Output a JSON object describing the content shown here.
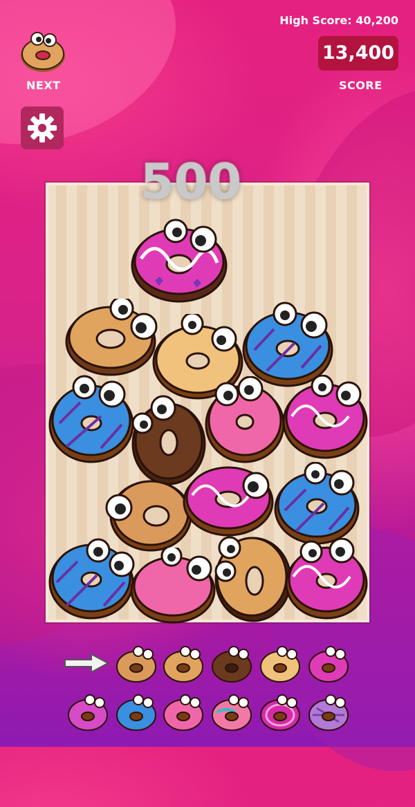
{
  "hud": {
    "next_label": "NEXT",
    "score_label": "SCORE",
    "high_score_text": "High Score: 40,200",
    "score_value": "13,400",
    "points_popup": "500"
  },
  "colors": {
    "score_box": "#b2133f",
    "settings_button": "#b1285f",
    "board_light": "#f0dfc8",
    "board_dark": "#e8d1b5"
  },
  "icons": [
    "next-donut-icon",
    "gear-icon",
    "right-arrow-icon"
  ],
  "evolution_order": [
    "plain-donut",
    "glazed-donut",
    "chocolate-sprinkle-donut",
    "white-sprinkle-donut",
    "pink-drizzle-donut",
    "purple-heart-donut",
    "blue-sprinkle-donut",
    "pink-frosted-donut",
    "teal-sprinkle-donut",
    "magenta-swirl-donut",
    "lavender-donut"
  ]
}
